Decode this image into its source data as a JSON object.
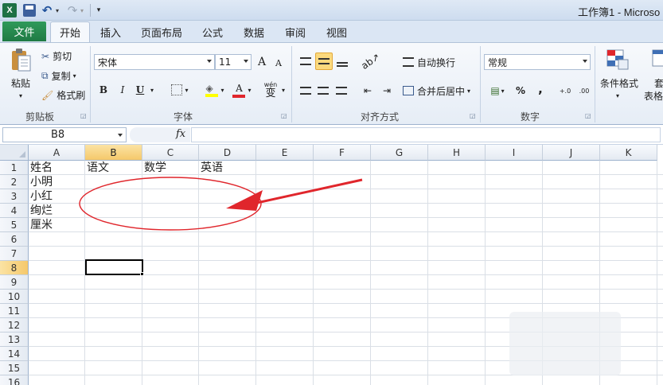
{
  "window": {
    "title": "工作簿1 - Microso"
  },
  "quick_access": {
    "logo": "X",
    "undo_icon": "↶",
    "redo_icon": "↷",
    "dropdown": "▾",
    "customize": "▾"
  },
  "tabs": [
    {
      "label": "文件"
    },
    {
      "label": "开始"
    },
    {
      "label": "插入"
    },
    {
      "label": "页面布局"
    },
    {
      "label": "公式"
    },
    {
      "label": "数据"
    },
    {
      "label": "审阅"
    },
    {
      "label": "视图"
    }
  ],
  "ribbon": {
    "clipboard": {
      "paste": "粘贴",
      "cut": "剪切",
      "copy": "复制",
      "format_painter": "格式刷",
      "group": "剪贴板"
    },
    "font": {
      "name": "宋体",
      "size": "11",
      "bold": "B",
      "italic": "I",
      "underline": "U",
      "grow": "A",
      "shrink": "A",
      "phonetic": "wén",
      "phonetic_char": "变",
      "group": "字体"
    },
    "alignment": {
      "wrap": "自动换行",
      "merge": "合并后居中",
      "group": "对齐方式"
    },
    "number": {
      "format": "常规",
      "percent": "%",
      "comma": ",",
      "inc_dec": "+.0",
      "dec_dec": ".00",
      "group": "数字"
    },
    "styles": {
      "conditional": "条件格式",
      "table1": "套",
      "table2": "表格"
    }
  },
  "formula_bar": {
    "name_box": "B8",
    "fx": "fx",
    "formula": ""
  },
  "grid": {
    "columns": [
      "A",
      "B",
      "C",
      "D",
      "E",
      "F",
      "G",
      "H",
      "I",
      "J",
      "K"
    ],
    "rows": [
      "1",
      "2",
      "3",
      "4",
      "5",
      "6",
      "7",
      "8",
      "9",
      "10",
      "11",
      "12",
      "13",
      "14",
      "15",
      "16"
    ],
    "cells": {
      "A1": "姓名",
      "B1": "语文",
      "C1": "数学",
      "D1": "英语",
      "A2": "小明",
      "A3": "小红",
      "A4": "绚烂",
      "A5": "厘米"
    },
    "selected": "B8"
  },
  "annotation": {
    "color": "#e0262c"
  }
}
